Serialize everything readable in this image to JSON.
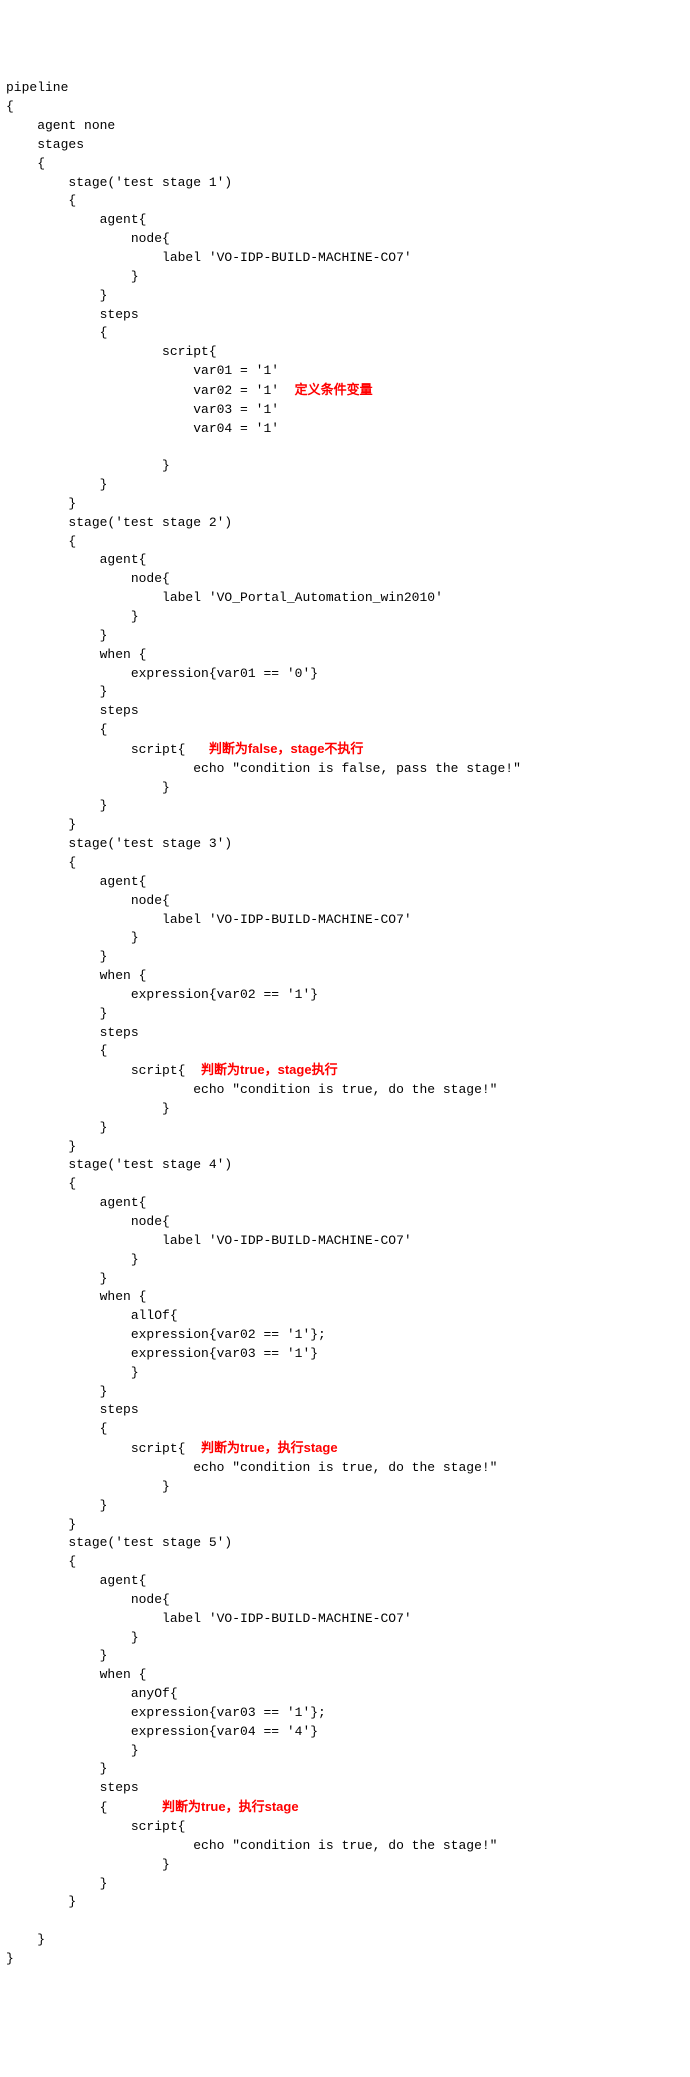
{
  "code": {
    "l01": "pipeline",
    "l02": "{",
    "l03": "    agent none",
    "l04": "    stages",
    "l05": "    {",
    "l06": "        stage('test stage 1')",
    "l07": "        {",
    "l08": "            agent{",
    "l09": "                node{",
    "l10": "                    label 'VO-IDP-BUILD-MACHINE-CO7'",
    "l11": "                }",
    "l12": "            }",
    "l13": "            steps",
    "l14": "            {",
    "l15": "                    script{",
    "l16": "                        var01 = '1'",
    "l17a": "                        var02 = '1'  ",
    "l18": "                        var03 = '1'",
    "l19": "                        var04 = '1'",
    "l21": "                    }",
    "l22": "            }",
    "l23": "        }",
    "l24": "        stage('test stage 2')",
    "l25": "        {",
    "l26": "            agent{",
    "l27": "                node{",
    "l28": "                    label 'VO_Portal_Automation_win2010'",
    "l29": "                }",
    "l30": "            }",
    "l31": "            when {",
    "l32": "                expression{var01 == '0'}",
    "l33": "            }",
    "l34": "            steps",
    "l35": "            {",
    "l36a": "                script{   ",
    "l37": "                        echo \"condition is false, pass the stage!\"",
    "l38": "                    }",
    "l39": "            }",
    "l40": "        }",
    "l41": "        stage('test stage 3')",
    "l42": "        {",
    "l43": "            agent{",
    "l44": "                node{",
    "l45": "                    label 'VO-IDP-BUILD-MACHINE-CO7'",
    "l46": "                }",
    "l47": "            }",
    "l48": "            when {",
    "l49": "                expression{var02 == '1'}",
    "l50": "            }",
    "l51": "            steps",
    "l52": "            {",
    "l53a": "                script{  ",
    "l54": "                        echo \"condition is true, do the stage!\"",
    "l55": "                    }",
    "l56": "            }",
    "l57": "        }",
    "l58": "        stage('test stage 4')",
    "l59": "        {",
    "l60": "            agent{",
    "l61": "                node{",
    "l62": "                    label 'VO-IDP-BUILD-MACHINE-CO7'",
    "l63": "                }",
    "l64": "            }",
    "l65": "            when {",
    "l66": "                allOf{",
    "l67": "                expression{var02 == '1'};",
    "l68": "                expression{var03 == '1'}",
    "l69": "                }",
    "l70": "            }",
    "l71": "            steps",
    "l72": "            {",
    "l73a": "                script{  ",
    "l74": "                        echo \"condition is true, do the stage!\"",
    "l75": "                    }",
    "l76": "            }",
    "l77": "        }",
    "l78": "        stage('test stage 5')",
    "l79": "        {",
    "l80": "            agent{",
    "l81": "                node{",
    "l82": "                    label 'VO-IDP-BUILD-MACHINE-CO7'",
    "l83": "                }",
    "l84": "            }",
    "l85": "            when {",
    "l86": "                anyOf{",
    "l87": "                expression{var03 == '1'};",
    "l88": "                expression{var04 == '4'}",
    "l89": "                }",
    "l90": "            }",
    "l91": "            steps",
    "l92a": "            {       ",
    "l93": "                script{",
    "l94": "                        echo \"condition is true, do the stage!\"",
    "l95": "                    }",
    "l96": "            }",
    "l97": "        }",
    "l99": "    }",
    "l100": "}"
  },
  "notes": {
    "n1": "定义条件变量",
    "n2": "判断为false，stage不执行",
    "n3": "判断为true，stage执行",
    "n4": "判断为true，执行stage",
    "n5": "判断为true，执行stage"
  }
}
